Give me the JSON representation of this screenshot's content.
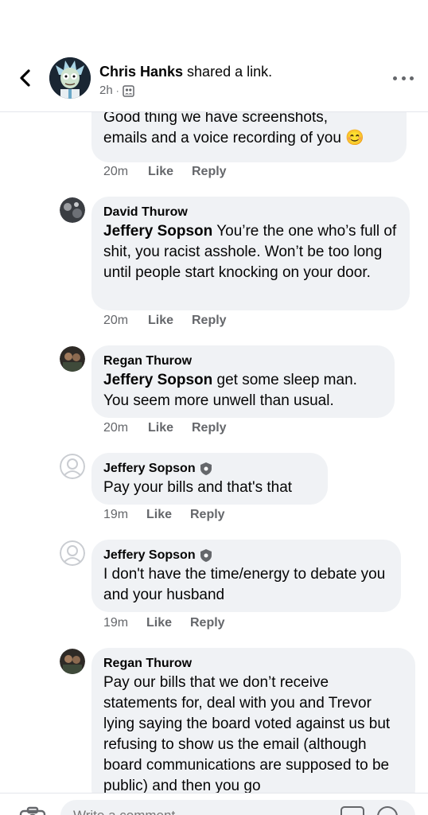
{
  "header": {
    "author": "Chris Hanks",
    "action": " shared a link.",
    "time": "2h",
    "separator": "·"
  },
  "comments": [
    {
      "name": "",
      "mention": "",
      "text_lines": [
        "Good thing we have screenshots,",
        "emails and a voice recording of you 😊"
      ],
      "time": "20m",
      "like": "Like",
      "reply": "Reply"
    },
    {
      "name": "David Thurow",
      "mention": "Jeffery Sopson",
      "text": " You’re the one who’s full of shit, you racist asshole. Won’t be too long until people start knocking on your door.",
      "time": "20m",
      "like": "Like",
      "reply": "Reply"
    },
    {
      "name": "Regan Thurow",
      "mention": "Jeffery Sopson",
      "text": " get some sleep man. You seem more unwell than usual.",
      "time": "20m",
      "like": "Like",
      "reply": "Reply"
    },
    {
      "name": "Jeffery Sopson",
      "mention": "",
      "text": "Pay your bills and that's that",
      "time": "19m",
      "like": "Like",
      "reply": "Reply"
    },
    {
      "name": "Jeffery Sopson",
      "mention": "",
      "text": "I don't have the time/energy to debate you and your husband",
      "time": "19m",
      "like": "Like",
      "reply": "Reply"
    },
    {
      "name": "Regan Thurow",
      "mention": "",
      "text": "Pay our bills that we don’t receive statements for, deal with you and Trevor lying saying the board voted against us but refusing to show us the email (although board communications are supposed to be public) and then you go"
    }
  ],
  "composer": {
    "placeholder": "Write a comment..."
  },
  "colors": {
    "bubble": "#f0f2f5",
    "secondary_text": "#65676b",
    "primary_text": "#050505"
  },
  "icons": [
    "back-arrow-icon",
    "audience-icon",
    "more-icon",
    "shield-icon",
    "camera-icon",
    "gif-icon",
    "emoji-icon"
  ]
}
